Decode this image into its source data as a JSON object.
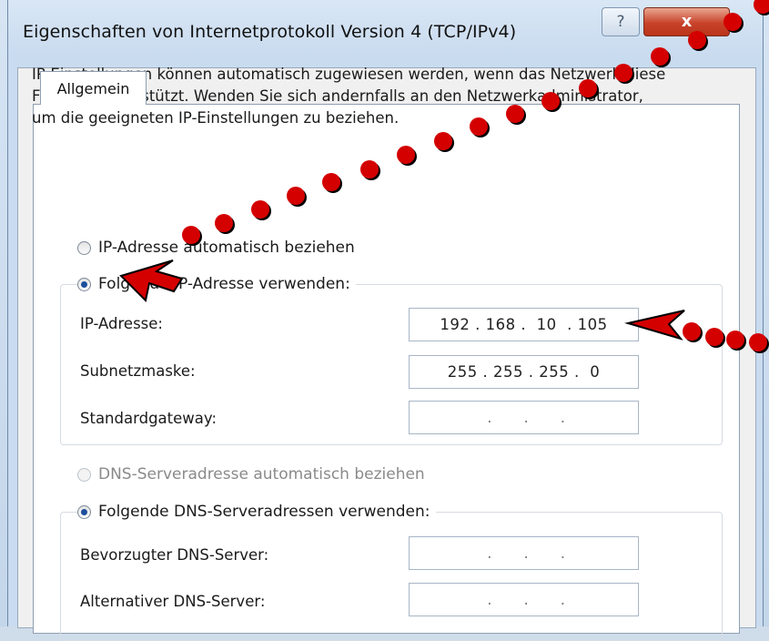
{
  "window": {
    "title": "Eigenschaften von Internetprotokoll Version 4 (TCP/IPv4)",
    "help_label": "?",
    "close_label": "x"
  },
  "tabs": [
    {
      "label": "Allgemein"
    }
  ],
  "info_text": "IP-Einstellungen können automatisch zugewiesen werden, wenn das Netzwerk diese Funktion unterstützt. Wenden Sie sich andernfalls an den Netzwerkadministrator, um die geeigneten IP-Einstellungen zu beziehen.",
  "ip_section": {
    "auto_option": "IP-Adresse automatisch beziehen",
    "manual_option": "Folgende IP-Adresse verwenden:",
    "selected": "manual",
    "fields": [
      {
        "label": "IP-Adresse:",
        "value": "192 . 168 .  10  . 105"
      },
      {
        "label": "Subnetzmaske:",
        "value": "255 . 255 . 255 .  0"
      },
      {
        "label": "Standardgateway:",
        "value": "    .      .      .   "
      }
    ]
  },
  "dns_section": {
    "auto_option": "DNS-Serveradresse automatisch beziehen",
    "manual_option": "Folgende DNS-Serveradressen verwenden:",
    "selected": "manual",
    "fields": [
      {
        "label": "Bevorzugter DNS-Server:",
        "value": "    .      .      .   "
      },
      {
        "label": "Alternativer DNS-Server:",
        "value": "    .      .      .   "
      }
    ]
  },
  "annotation": {
    "color": "#d40000"
  }
}
